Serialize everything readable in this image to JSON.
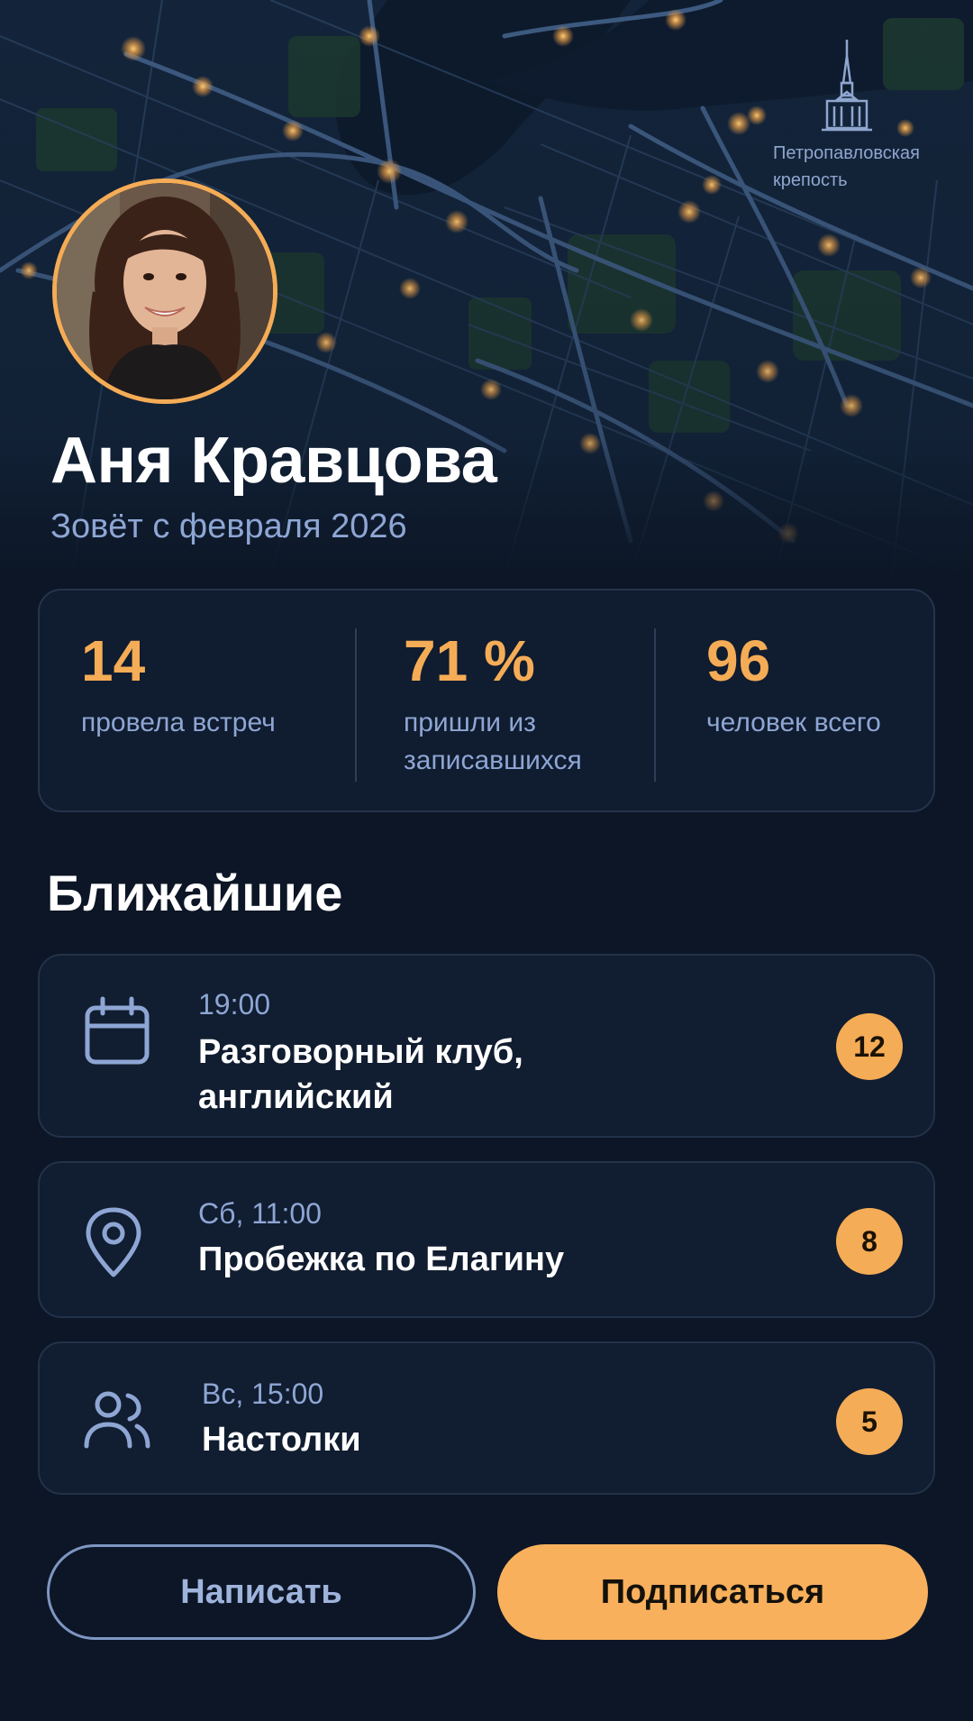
{
  "header": {
    "landmark_label": "Петропавловская крепость",
    "landmark_icon": "cathedral-spire-icon"
  },
  "profile": {
    "name": "Аня Кравцова",
    "since": "Зовёт с февраля 2026"
  },
  "stats": [
    {
      "value": "14",
      "label": "провела встреч"
    },
    {
      "value": "71 %",
      "label": "пришли из записавшихся"
    },
    {
      "value": "96",
      "label": "человек всего"
    }
  ],
  "upcoming": {
    "title": "Ближайшие",
    "events": [
      {
        "time": "19:00",
        "title": "Разговорный клуб, английский",
        "count": "12",
        "icon": "calendar-icon"
      },
      {
        "time": "Сб, 11:00",
        "title": "Пробежка по Елагину",
        "count": "8",
        "icon": "map-pin-icon"
      },
      {
        "time": "Вс, 15:00",
        "title": "Настолки",
        "count": "5",
        "icon": "people-icon"
      }
    ]
  },
  "actions": {
    "write_label": "Написать",
    "subscribe_label": "Подписаться"
  },
  "colors": {
    "accent": "#f5ac56",
    "background": "#0c1626",
    "muted_text": "#8ea6d4"
  }
}
